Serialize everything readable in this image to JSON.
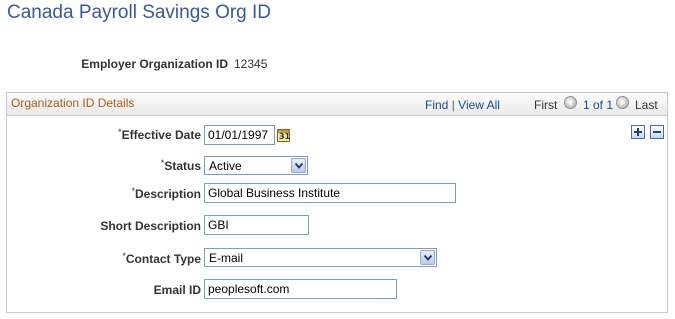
{
  "page": {
    "title": "Canada Payroll Savings Org ID"
  },
  "employer": {
    "label": "Employer Organization ID",
    "value": "12345"
  },
  "group": {
    "title": "Organization ID Details",
    "nav": {
      "find": "Find",
      "separator": "|",
      "view_all": "View All",
      "first": "First",
      "page_text": "1 of 1",
      "last": "Last"
    }
  },
  "form": {
    "required_mark": "*",
    "effective_date": {
      "label": "Effective Date",
      "value": "01/01/1997",
      "calendar_text": "31"
    },
    "status": {
      "label": "Status",
      "value": "Active"
    },
    "description": {
      "label": "Description",
      "value": "Global Business Institute"
    },
    "short_description": {
      "label": "Short Description",
      "value": "GBI"
    },
    "contact_type": {
      "label": "Contact Type",
      "value": "E-mail"
    },
    "email_id": {
      "label": "Email ID",
      "value": "peoplesoft.com"
    }
  },
  "icons": {
    "prev": "arrow-left-icon",
    "next": "arrow-right-icon",
    "add": "plus-icon",
    "delete": "minus-icon",
    "calendar": "calendar-icon",
    "dropdown": "chevron-down-icon"
  },
  "colors": {
    "title": "#3a5999",
    "group_title": "#b15a18",
    "link": "#1b4b8c",
    "input_border": "#7f9db9"
  }
}
